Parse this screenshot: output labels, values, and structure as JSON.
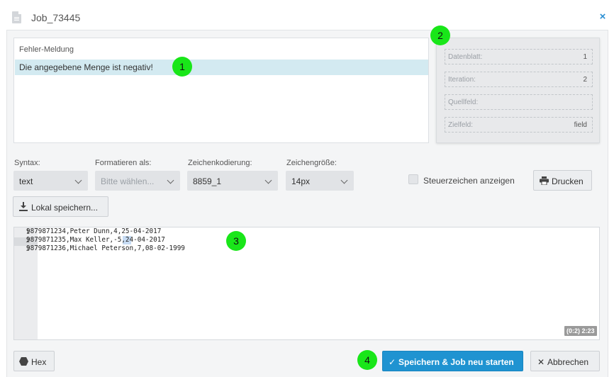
{
  "window": {
    "title": "Job_73445",
    "icon": "document-icon",
    "close_icon": "close-icon"
  },
  "error_panel": {
    "header": "Fehler-Meldung",
    "message": "Die angegebene Menge ist negativ!"
  },
  "info_panel": {
    "fields": [
      {
        "label": "Datenblatt:",
        "value": "1"
      },
      {
        "label": "Iteration:",
        "value": "2"
      },
      {
        "label": "Quellfeld:",
        "value": ""
      },
      {
        "label": "Zielfeld:",
        "value": "field"
      }
    ]
  },
  "toolbar": {
    "syntax": {
      "label": "Syntax:",
      "value": "text"
    },
    "format": {
      "label": "Formatieren als:",
      "placeholder": "Bitte wählen..."
    },
    "encoding": {
      "label": "Zeichenkodierung:",
      "value": "8859_1"
    },
    "font_size": {
      "label": "Zeichengröße:",
      "value": "14px"
    },
    "control_chars_label": "Steuerzeichen anzeigen",
    "print_label": "Drucken",
    "save_local_label": "Lokal speichern..."
  },
  "editor": {
    "lines": [
      {
        "num": "1",
        "text": "9879871234,Peter Dunn,4,25-04-2017"
      },
      {
        "num": "2",
        "text": "9879871235,Max Keller,-5,24-04-2017"
      },
      {
        "num": "3",
        "text": "9879871236,Michael Peterson,7,08-02-1999"
      }
    ],
    "active_line": 2,
    "cursor_info": "(0:2) 2:23"
  },
  "footer": {
    "hex_label": "Hex",
    "save_restart_label": "Speichern & Job neu starten",
    "cancel_label": "Abbrechen"
  },
  "markers": [
    "1",
    "2",
    "3",
    "4"
  ],
  "colors": {
    "accent": "#1f93d1",
    "selection_row": "#d3eaf1",
    "marker": "#19e619"
  }
}
